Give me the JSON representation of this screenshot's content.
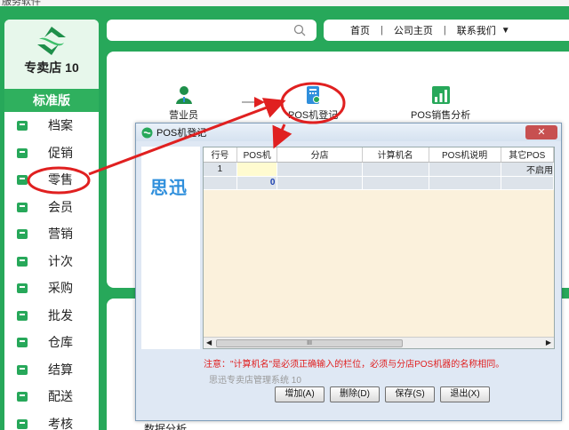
{
  "app": {
    "title_fragment": "服务软件",
    "store_name": "专卖店 10",
    "edition": "标准版"
  },
  "sidebar": {
    "items": [
      {
        "label": "档案",
        "icon": "archive-icon"
      },
      {
        "label": "促销",
        "icon": "tag-icon"
      },
      {
        "label": "零售",
        "icon": "shop-icon"
      },
      {
        "label": "会员",
        "icon": "member-icon"
      },
      {
        "label": "营销",
        "icon": "marketing-icon"
      },
      {
        "label": "计次",
        "icon": "count-icon"
      },
      {
        "label": "采购",
        "icon": "basket-icon"
      },
      {
        "label": "批发",
        "icon": "wholesale-icon"
      },
      {
        "label": "仓库",
        "icon": "warehouse-icon"
      },
      {
        "label": "结算",
        "icon": "settle-icon"
      },
      {
        "label": "配送",
        "icon": "delivery-icon"
      },
      {
        "label": "考核",
        "icon": "assess-icon"
      }
    ]
  },
  "nav": {
    "home": "首页",
    "company": "公司主页",
    "contact": "联系我们"
  },
  "flow": {
    "salesperson": "营业员",
    "pos_register": "POS机登记",
    "pos_analysis": "POS销售分析"
  },
  "dialog": {
    "title": "POS机登记",
    "brand": "思迅",
    "close": "✕",
    "columns": [
      "行号",
      "POS机",
      "分店",
      "计算机名",
      "POS机说明",
      "其它POS"
    ],
    "rows": [
      [
        "1",
        "",
        "",
        "",
        "",
        "不启用"
      ],
      [
        "",
        "0",
        "",
        "",
        "",
        ""
      ]
    ],
    "scroll_thumb": "III",
    "notice": "注意：\"计算机名\"是必须正确输入的栏位，必须与分店POS机器的名称相同。",
    "system_caption": "思迅专卖店管理系统 10",
    "buttons": {
      "add": "增加(A)",
      "delete": "删除(D)",
      "save": "保存(S)",
      "exit": "退出(X)"
    }
  },
  "bottom_peek": "数据分析",
  "colors": {
    "brand_green": "#27a85a",
    "annotation_red": "#e02020",
    "accent_blue": "#2f8fdc"
  }
}
